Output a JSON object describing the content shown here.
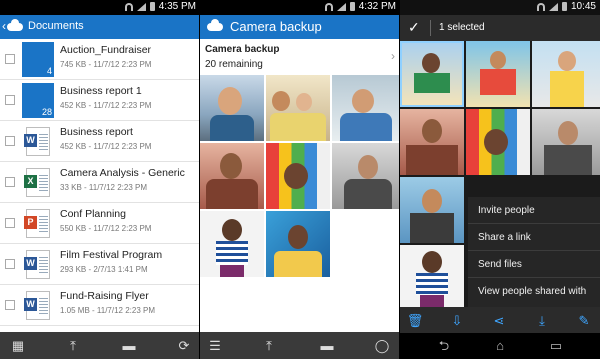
{
  "phone1": {
    "status_time": "4:35 PM",
    "header_title": "Documents",
    "files": [
      {
        "name": "Auction_Fundraiser",
        "meta": "745 KB - 11/7/12 2:23 PM",
        "type": "folder",
        "count": "4"
      },
      {
        "name": "Business report 1",
        "meta": "452 KB - 11/7/12 2:23 PM",
        "type": "folder",
        "count": "28"
      },
      {
        "name": "Business report",
        "meta": "452 KB - 11/7/12 2:23 PM",
        "type": "word",
        "badge": "W"
      },
      {
        "name": "Camera Analysis - Generic",
        "meta": "33 KB - 11/7/12 2:23 PM",
        "type": "excel",
        "badge": "X"
      },
      {
        "name": "Conf Planning",
        "meta": "550 KB - 11/7/12 2:23 PM",
        "type": "powerpoint",
        "badge": "P"
      },
      {
        "name": "Film Festival Program",
        "meta": "293 KB - 2/7/13 1:41 PM",
        "type": "word",
        "badge": "W"
      },
      {
        "name": "Fund-Raising Flyer",
        "meta": "1.05 MB - 11/7/12 2:23 PM",
        "type": "word",
        "badge": "W"
      }
    ],
    "toolbar_icons": [
      "grid-view-icon",
      "upload-icon",
      "new-folder-icon",
      "refresh-icon"
    ]
  },
  "phone2": {
    "status_time": "4:32 PM",
    "header_title": "Camera backup",
    "section_title": "Camera backup",
    "remaining": "20 remaining",
    "toolbar_icons": [
      "list-view-icon",
      "upload-icon",
      "new-folder-icon",
      "select-icon"
    ]
  },
  "phone3": {
    "status_time": "10:45",
    "selection_label": "1 selected",
    "menu_items": [
      "Invite people",
      "Share a link",
      "Send files",
      "View people shared with"
    ],
    "action_icons": [
      "delete-icon",
      "move-icon",
      "share-icon",
      "download-icon",
      "rename-icon"
    ],
    "nav_icons": [
      "back-icon",
      "home-icon",
      "recent-apps-icon"
    ]
  },
  "colors": {
    "brand_blue": "#1a74c6",
    "accent_blue": "#3fa6ff",
    "word": "#2b5797",
    "excel": "#1e7145",
    "powerpoint": "#d24726"
  }
}
